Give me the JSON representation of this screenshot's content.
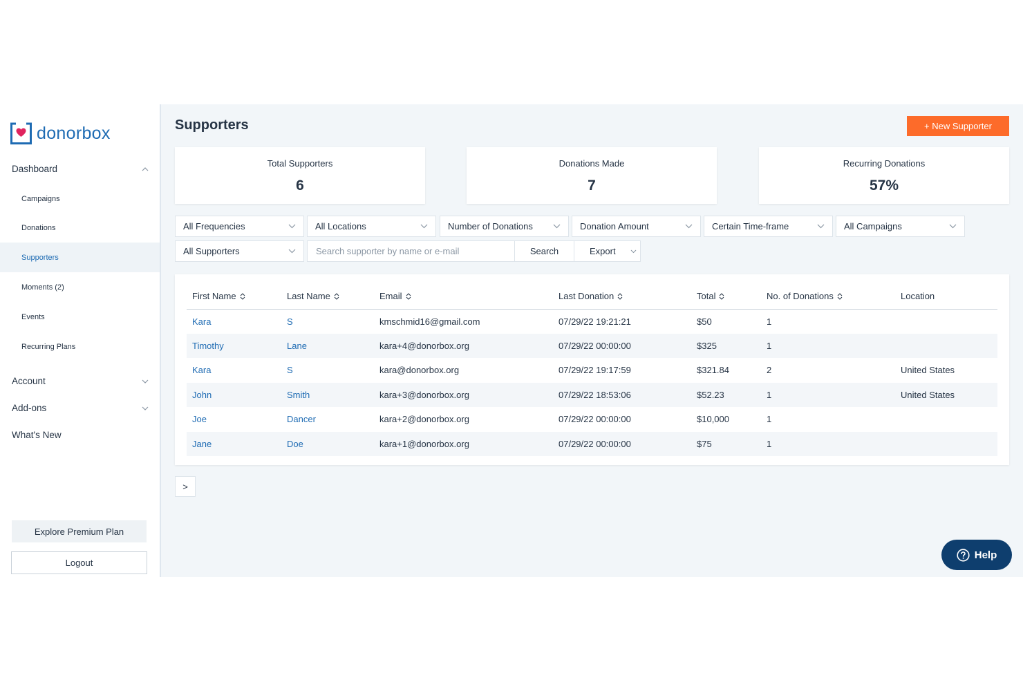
{
  "brand": {
    "name": "donorbox",
    "color": "#1e6bb3",
    "heart_color": "#e0245e"
  },
  "sidebar": {
    "dashboard_label": "Dashboard",
    "sub_items": [
      {
        "label": "Campaigns"
      },
      {
        "label": "Donations"
      },
      {
        "label": "Supporters",
        "active": true
      },
      {
        "label": "Moments (2)"
      },
      {
        "label": "Events"
      },
      {
        "label": "Recurring Plans"
      }
    ],
    "account_label": "Account",
    "addons_label": "Add-ons",
    "whats_new_label": "What's New",
    "premium_label": "Explore Premium Plan",
    "logout_label": "Logout"
  },
  "header": {
    "title": "Supporters",
    "new_button_label": "+ New Supporter",
    "accent_color": "#fd6b2a"
  },
  "stats": [
    {
      "label": "Total Supporters",
      "value": "6"
    },
    {
      "label": "Donations Made",
      "value": "7"
    },
    {
      "label": "Recurring Donations",
      "value": "57%"
    }
  ],
  "filters": {
    "frequency": "All Frequencies",
    "locations": "All Locations",
    "num_donations": "Number of Donations",
    "amount": "Donation Amount",
    "timeframe": "Certain Time-frame",
    "campaigns": "All Campaigns",
    "supporters": "All Supporters"
  },
  "search": {
    "placeholder": "Search supporter by name or e-mail",
    "button_label": "Search",
    "export_label": "Export"
  },
  "table": {
    "columns": [
      {
        "label": "First Name",
        "sortable": true
      },
      {
        "label": "Last Name",
        "sortable": true
      },
      {
        "label": "Email",
        "sortable": true
      },
      {
        "label": "Last Donation",
        "sortable": true
      },
      {
        "label": "Total",
        "sortable": true
      },
      {
        "label": "No. of Donations",
        "sortable": true
      },
      {
        "label": "Location",
        "sortable": false
      }
    ],
    "rows": [
      {
        "first": "Kara",
        "last": "S",
        "email": "kmschmid16@gmail.com",
        "last_donation": "07/29/22 19:21:21",
        "total": "$50",
        "count": "1",
        "location": ""
      },
      {
        "first": "Timothy",
        "last": "Lane",
        "email": "kara+4@donorbox.org",
        "last_donation": "07/29/22 00:00:00",
        "total": "$325",
        "count": "1",
        "location": ""
      },
      {
        "first": "Kara",
        "last": "S",
        "email": "kara@donorbox.org",
        "last_donation": "07/29/22 19:17:59",
        "total": "$321.84",
        "count": "2",
        "location": "United States"
      },
      {
        "first": "John",
        "last": "Smith",
        "email": "kara+3@donorbox.org",
        "last_donation": "07/29/22 18:53:06",
        "total": "$52.23",
        "count": "1",
        "location": "United States"
      },
      {
        "first": "Joe",
        "last": "Dancer",
        "email": "kara+2@donorbox.org",
        "last_donation": "07/29/22 00:00:00",
        "total": "$10,000",
        "count": "1",
        "location": ""
      },
      {
        "first": "Jane",
        "last": "Doe",
        "email": "kara+1@donorbox.org",
        "last_donation": "07/29/22 00:00:00",
        "total": "$75",
        "count": "1",
        "location": ""
      }
    ]
  },
  "pagination": {
    "next_label": ">"
  },
  "help": {
    "label": "Help",
    "color": "#0e3e6e"
  }
}
